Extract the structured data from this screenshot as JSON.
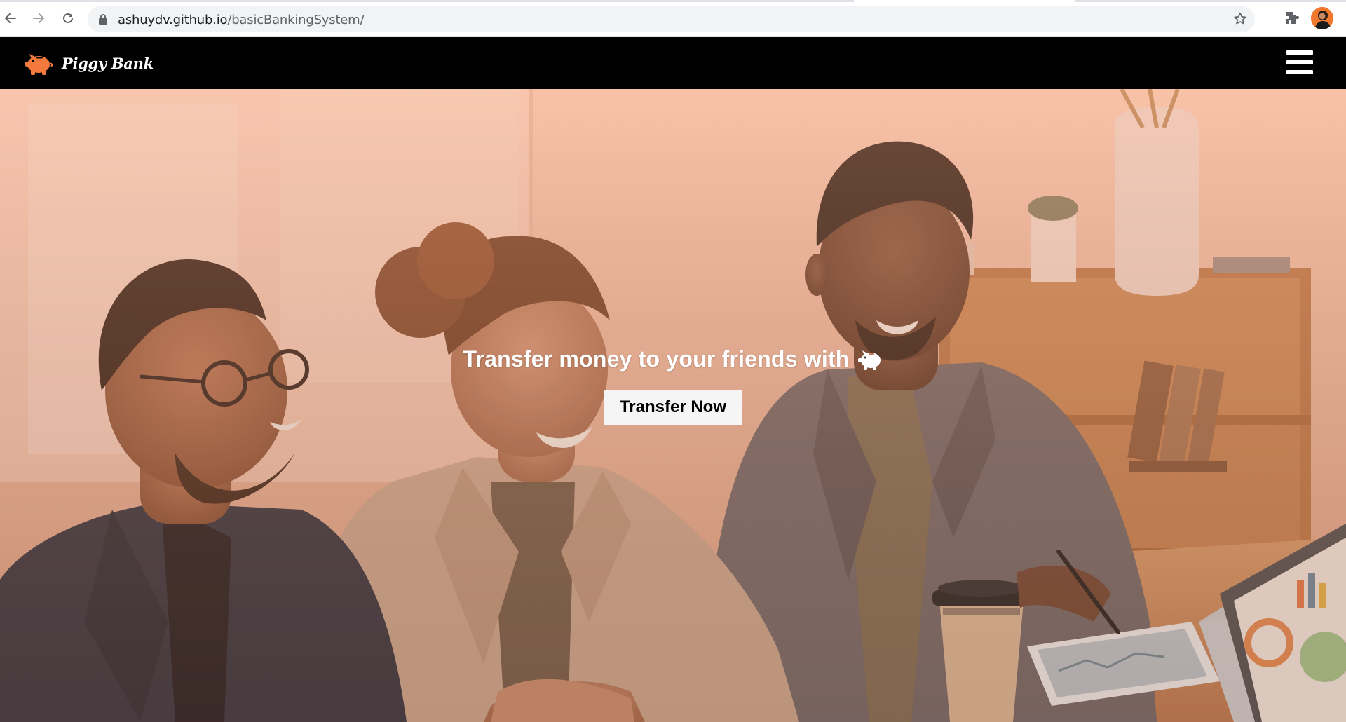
{
  "browser": {
    "url_host": "ashuydv.github.io",
    "url_path": "/basicBankingSystem/",
    "icons": [
      "back-arrow-icon",
      "forward-arrow-icon",
      "reload-icon",
      "lock-icon",
      "star-icon",
      "puzzle-extension-icon",
      "profile-avatar"
    ]
  },
  "navbar": {
    "brand_name": "Piggy Bank",
    "logo_icon": "piggy-bank-icon",
    "menu_icon": "hamburger-menu-icon",
    "brand_color": "#f37a3c"
  },
  "hero": {
    "title": "Transfer money to your friends with",
    "title_icon": "piggy-bank-icon",
    "cta_label": "Transfer Now",
    "background": "photo of three smiling colleagues at a table with warm peach overlay"
  }
}
